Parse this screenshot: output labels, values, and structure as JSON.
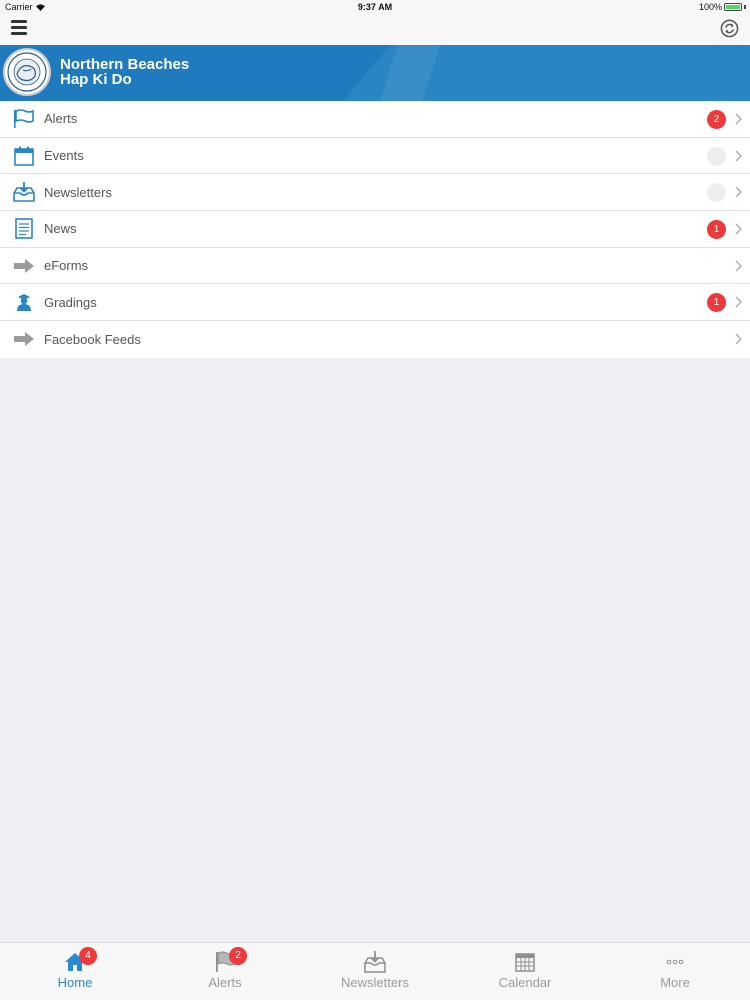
{
  "status": {
    "carrier": "Carrier",
    "time": "9:37 AM",
    "battery": "100%",
    "battery_level": 1.0
  },
  "header": {
    "org_line1": "Northern Beaches",
    "org_line2": "Hap Ki Do"
  },
  "colors": {
    "brand": "#2a85c4",
    "badge": "#ec3a3a",
    "active_tab": "#2a8ad0"
  },
  "menu": {
    "items": [
      {
        "label": "Alerts",
        "icon": "flag-icon",
        "badge": "2"
      },
      {
        "label": "Events",
        "icon": "calendar-icon",
        "badge": ""
      },
      {
        "label": "Newsletters",
        "icon": "inbox-download-icon",
        "badge": ""
      },
      {
        "label": "News",
        "icon": "document-icon",
        "badge": "1"
      },
      {
        "label": "eForms",
        "icon": "arrow-right-icon",
        "badge": null
      },
      {
        "label": "Gradings",
        "icon": "graduate-icon",
        "badge": "1"
      },
      {
        "label": "Facebook Feeds",
        "icon": "arrow-right-icon",
        "badge": null
      }
    ]
  },
  "tabs": [
    {
      "label": "Home",
      "icon": "home-icon",
      "badge": "4",
      "active": true
    },
    {
      "label": "Alerts",
      "icon": "flag-icon",
      "badge": "2",
      "active": false
    },
    {
      "label": "Newsletters",
      "icon": "inbox-download-icon",
      "badge": null,
      "active": false
    },
    {
      "label": "Calendar",
      "icon": "calendar-icon",
      "badge": null,
      "active": false
    },
    {
      "label": "More",
      "icon": "more-icon",
      "badge": null,
      "active": false
    }
  ]
}
